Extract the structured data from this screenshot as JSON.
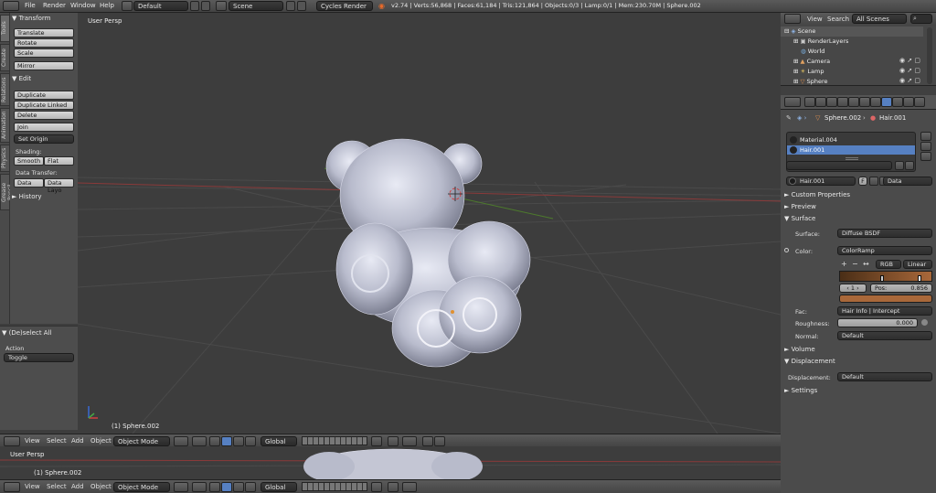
{
  "topbar": {
    "menus": [
      "File",
      "Render",
      "Window",
      "Help"
    ],
    "screen_layout": "Default",
    "scene": "Scene",
    "engine": "Cycles Render",
    "stats": "v2.74 | Verts:56,868 | Faces:61,184 | Tris:121,864 | Objects:0/3 | Lamp:0/1 | Mem:230.70M | Sphere.002"
  },
  "toolshelf": {
    "tabs": [
      "Tools",
      "Create",
      "Relations",
      "Animation",
      "Physics",
      "Grease Pencil"
    ],
    "transform": {
      "header": "Transform",
      "buttons": [
        "Translate",
        "Rotate",
        "Scale",
        "Mirror"
      ]
    },
    "edit": {
      "header": "Edit",
      "buttons": [
        "Duplicate",
        "Duplicate Linked",
        "Delete",
        "Join"
      ],
      "set_origin": "Set Origin",
      "shading_label": "Shading:",
      "smooth": "Smooth",
      "flat": "Flat",
      "data_transfer_label": "Data Transfer:",
      "data": "Data",
      "data_layout": "Data Layo"
    },
    "history": "History"
  },
  "last_operator": {
    "header": "(De)select All",
    "action_label": "Action",
    "action_value": "Toggle"
  },
  "viewport": {
    "label": "User Persp",
    "object_label": "(1) Sphere.002"
  },
  "viewport2": {
    "label": "User Persp",
    "object_label": "(1) Sphere.002"
  },
  "view_header": {
    "menus": [
      "View",
      "Select",
      "Add",
      "Object"
    ],
    "mode": "Object Mode",
    "orientation": "Global"
  },
  "outliner": {
    "view": "View",
    "search": "Search",
    "filter": "All Scenes",
    "items": [
      {
        "label": "Scene",
        "indent": 0
      },
      {
        "label": "RenderLayers",
        "indent": 1
      },
      {
        "label": "World",
        "indent": 1
      },
      {
        "label": "Camera",
        "indent": 1
      },
      {
        "label": "Lamp",
        "indent": 1
      },
      {
        "label": "Sphere",
        "indent": 1
      }
    ]
  },
  "properties": {
    "breadcrumb_object": "Sphere.002",
    "breadcrumb_material": "Hair.001",
    "slots": [
      "Material.004",
      "Hair.001"
    ],
    "material_name": "Hair.001",
    "material_users": "F",
    "link": "Data",
    "panels": {
      "custom_properties": "Custom Properties",
      "preview": "Preview",
      "surface": "Surface",
      "volume": "Volume",
      "displacement": "Displacement",
      "settings": "Settings"
    },
    "surface": {
      "surface_label": "Surface:",
      "surface_value": "Diffuse BSDF",
      "color_label": "Color:",
      "color_value": "ColorRamp",
      "ramp_mode": "RGB",
      "ramp_interp": "Linear",
      "stop_index": "1",
      "pos_label": "Pos:",
      "pos_value": "0.856",
      "fac_label": "Fac:",
      "fac_value": "Hair Info | Intercept",
      "roughness_label": "Roughness:",
      "roughness_value": "0.000",
      "normal_label": "Normal:",
      "normal_value": "Default"
    },
    "displacement": {
      "label": "Displacement:",
      "value": "Default"
    }
  },
  "colors": {
    "ramp_brown": "#a9683a",
    "ramp_dark": "#4a2e16",
    "selected_slot": "#5680c2"
  }
}
